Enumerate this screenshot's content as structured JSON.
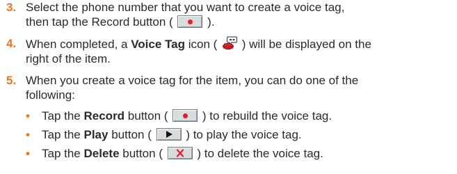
{
  "steps": [
    {
      "number": "3.",
      "line1": "Select the phone number that you want to create a voice tag,",
      "line2_prefix": "then tap the Record button (",
      "line2_suffix": ")."
    },
    {
      "number": "4.",
      "prefix": "When completed, a ",
      "bold": "Voice Tag",
      "middle": " icon (",
      "suffix": ") will be displayed on the",
      "line2": "right of the item."
    },
    {
      "number": "5.",
      "line1": "When you create a voice tag for the item, you can do one of the",
      "line2": "following:"
    }
  ],
  "bullets": [
    {
      "prefix": "Tap the ",
      "bold": "Record",
      "middle": " button (",
      "suffix": ") to rebuild the voice tag.",
      "icon": "record-icon"
    },
    {
      "prefix": "Tap the ",
      "bold": "Play",
      "middle": " button (",
      "suffix": ") to play the voice tag.",
      "icon": "play-icon"
    },
    {
      "prefix": "Tap the ",
      "bold": "Delete",
      "middle": " button (",
      "suffix": ") to delete the voice tag.",
      "icon": "delete-icon"
    }
  ],
  "colors": {
    "accent": "#e8761f",
    "text": "#2a2a2a",
    "record_dot": "#e0202a",
    "delete_x": "#e0202a",
    "button_face": "#d9dcdc"
  },
  "bullet_glyph": "•"
}
